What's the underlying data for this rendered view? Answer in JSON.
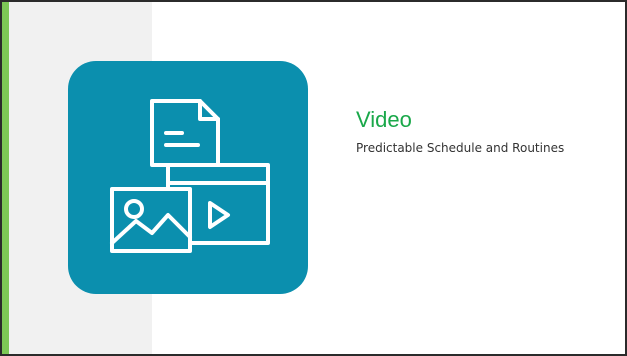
{
  "slide": {
    "title": "Video",
    "subtitle": "Predictable Schedule and Routines",
    "icon_name": "media-files-icon",
    "colors": {
      "accent": "#7dc856",
      "title": "#1aa84a",
      "tile": "#0b8fae",
      "panel": "#f1f1f1"
    }
  }
}
